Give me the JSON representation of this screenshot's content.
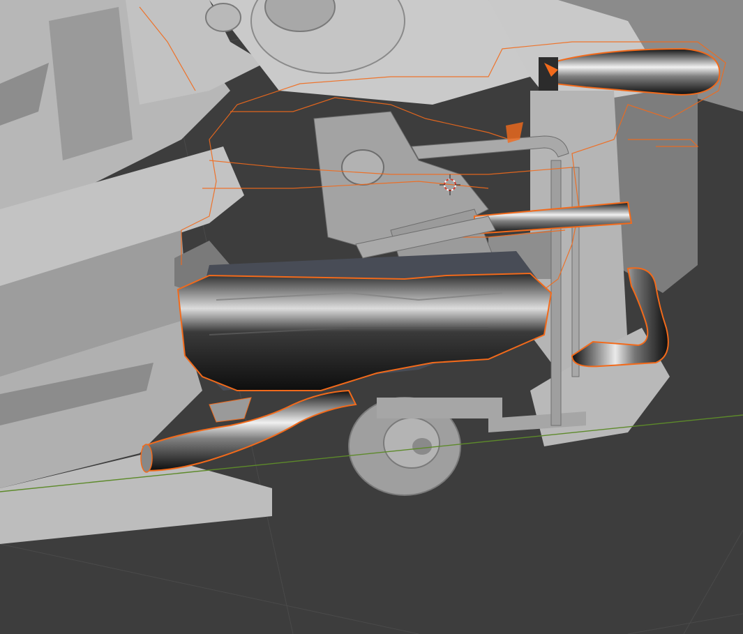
{
  "viewport": {
    "mode": "solid",
    "background": "#3d3d3d",
    "grid_line_color": "#4a4a4a",
    "x_axis_color": "#5d8a2a",
    "selection_outline_color": "#f26a1b",
    "active_outline_color": "#ff8a3a",
    "model_light_color": "#bdbdbd",
    "model_mid_color": "#9c9c9c",
    "model_shadow_color": "#6e6e6e",
    "chrome_highlight_color": "#f4f4f4",
    "chrome_dark_color": "#1c1c1c"
  },
  "scene": {
    "subject_icon": "car-chassis-engine-underside",
    "selected_parts": [
      "oil-pan",
      "exhaust-pipe-left",
      "exhaust-pipe-right",
      "upper-pipe",
      "engine-block-outline"
    ],
    "cursor_icon": "3d-cursor-icon"
  }
}
